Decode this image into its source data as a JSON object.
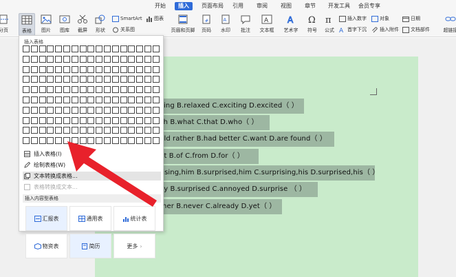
{
  "menu_tabs": [
    {
      "label": "开始",
      "active": false
    },
    {
      "label": "插入",
      "active": true
    },
    {
      "label": "页面布局",
      "active": false
    },
    {
      "label": "引用",
      "active": false
    },
    {
      "label": "审阅",
      "active": false
    },
    {
      "label": "视图",
      "active": false
    },
    {
      "label": "章节",
      "active": false
    },
    {
      "label": "开发工具",
      "active": false
    },
    {
      "label": "会员专享",
      "active": false
    }
  ],
  "ribbon": {
    "page_break_partial": "分页",
    "table": "表格",
    "picture": "图片",
    "shapes": "图库",
    "screenshot": "截屏",
    "shape": "形状",
    "icons": "图标",
    "smartart": "SmartArt",
    "chart": "图表",
    "relation": "关系图",
    "header_footer": "页眉和页脚",
    "page_number": "页码",
    "watermark": "水印",
    "comment": "批注",
    "textbox": "文本框",
    "wordart": "艺术字",
    "symbol": "符号",
    "formula": "公式",
    "insert_number": "插入数字",
    "object": "对象",
    "date": "日期",
    "drop_cap": "首字下沉",
    "attachment": "插入附件",
    "doc_parts": "文档部件",
    "hyperlink": "超链接"
  },
  "dropdown": {
    "title": "插入表格",
    "grid_rows": 10,
    "grid_cols": 17,
    "items": [
      {
        "label": "插入表格(I)",
        "state": "normal"
      },
      {
        "label": "绘制表格(W)",
        "state": "normal"
      },
      {
        "label": "文本转换成表格...",
        "state": "hover"
      },
      {
        "label": "表格转换成文本...",
        "state": "disabled"
      }
    ],
    "section_label": "插入内容型表格",
    "templates": [
      {
        "label": "汇报表"
      },
      {
        "label": "通用表"
      },
      {
        "label": "统计表"
      },
      {
        "label": "物资表"
      },
      {
        "label": "简历"
      },
      {
        "label": "更多"
      }
    ]
  },
  "document_lines": [
    "xing  B.relaxed  C.exciting  D.excited（      ）",
    "ch  B.what  C.that  D.who（      ）",
    "uld  rather  B.had  better  C.want  D.are  found（      ）",
    "ut  B.of  C.from  D.for（      ）",
    "rising,him  B.surprised,him  C.surprising,his  D.surprised,his（      ）",
    "oy  B.surprised  C.annoyed  D.surprise  （      ）",
    "ther  B.never  C.already  D.yet（      ）"
  ],
  "colors": {
    "accent": "#2f6bd8",
    "page": "#c9ebcb",
    "highlight": "#9db7a2",
    "arrow": "#e8212b"
  }
}
